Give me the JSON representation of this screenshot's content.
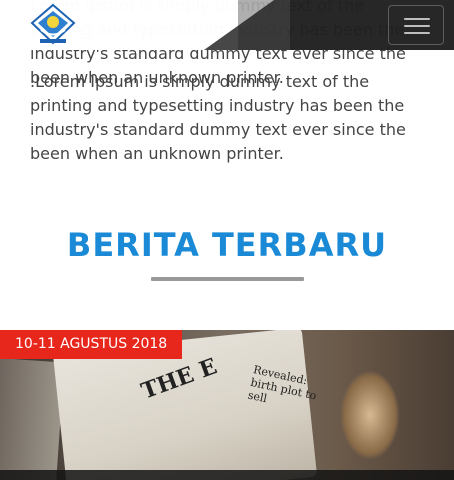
{
  "intro": {
    "partial_text": "Lorem Ipsum is simply dummy text of the printing and typesetting industry has been the industry's standard dummy text ever since the been when an unknown printer.",
    "paragraph": ".Lorem Ipsum is simply dummy text of the printing and typesetting industry has been the industry's standard dummy text ever since the been when an unknown printer."
  },
  "navbar": {
    "logo_icon": "school-emblem-icon",
    "toggle_icon": "hamburger-menu-icon"
  },
  "news_section": {
    "title": "BERITA TERBARU",
    "title_color": "#1a8ad6",
    "rule_color": "#999999",
    "cards": [
      {
        "date": "10-11 AGUSTUS 2018",
        "badge_color": "#e8271c",
        "image_icon": "newspaper-photo-icon"
      }
    ]
  }
}
